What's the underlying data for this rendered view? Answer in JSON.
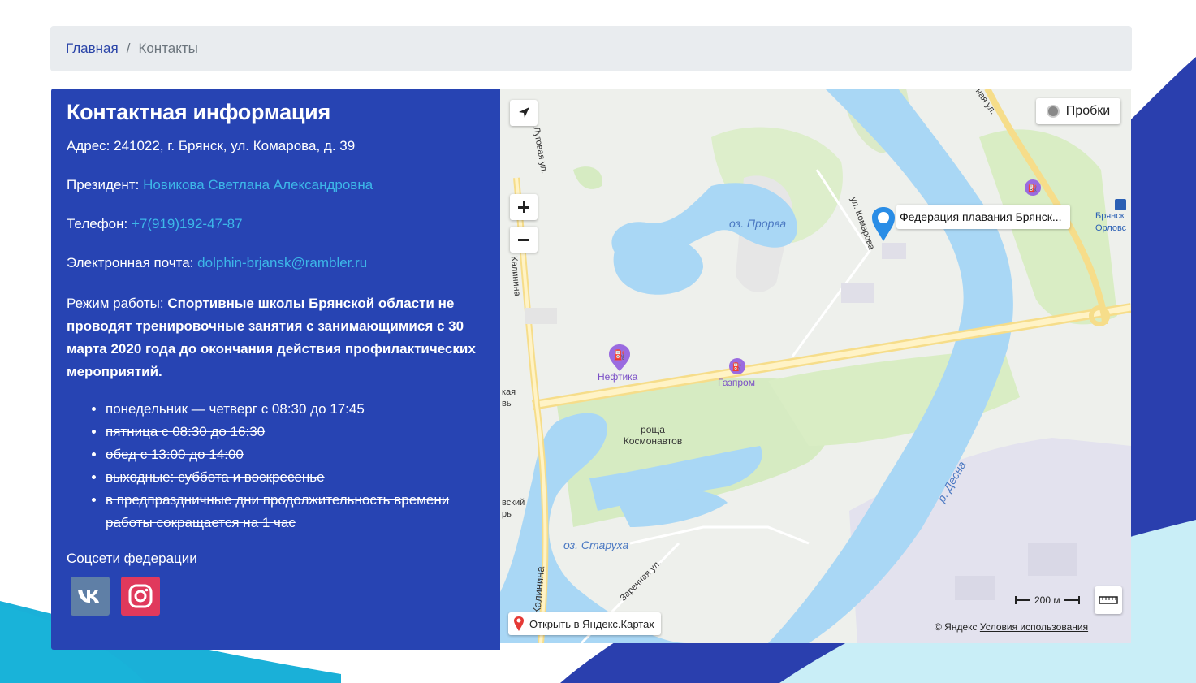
{
  "breadcrumb": {
    "home": "Главная",
    "separator": "/",
    "current": "Контакты"
  },
  "contacts": {
    "title": "Контактная информация",
    "address": "Адрес: 241022, г. Брянск, ул. Комарова, д. 39",
    "president_label": "Президент:",
    "president_name": "Новикова Светлана Александровна",
    "phone_label": "Телефон:",
    "phone": "+7(919)192-47-87",
    "email_label": "Электронная почта:",
    "email": "dolphin-brjansk@rambler.ru",
    "mode_label": "Режим работы:",
    "mode_text": "Спортивные школы Брянской области не проводят тренировочные занятия с занимающимися с 30 марта 2020 года до окончания действия профилактических мероприятий.",
    "schedule": [
      "понедельник — четверг с 08:30 до 17:45",
      "пятница с 08:30 до 16:30",
      "обед с 13:00 до 14:00",
      "выходные: суббота и воскресенье",
      "в предпраздничные дни продолжительность времени работы сокращается на 1 час"
    ],
    "social_title": "Соцсети федерации",
    "social": [
      {
        "name": "vk",
        "icon": "vk-icon",
        "color": "#5f7fa6"
      },
      {
        "name": "instagram",
        "icon": "instagram-icon",
        "color": "#e0395c"
      }
    ]
  },
  "map": {
    "traffic_label": "Пробки",
    "marker_label": "Федерация плавания Брянск...",
    "open_label": "Открыть в Яндекс.Картах",
    "scale_label": "200 м",
    "copyright": "© Яндекс",
    "terms": "Условия использования",
    "labels": {
      "lake1": "оз. Прорва",
      "lake2": "оз. Старуха",
      "river": "р. Десна",
      "poi1": "Нефтика",
      "poi2": "Газпром",
      "park": "роща Космонавтов",
      "street1": "ул. Комарова",
      "street2": "Луговая ул.",
      "street3": "Калинина",
      "street4": "Калинина",
      "street5": "Заречная ул.",
      "street6": "ная ул.",
      "city1": "Брянск",
      "city2": "Орловс",
      "left1": "кая",
      "left2": "вь",
      "left3": "вский",
      "left4": "рь"
    }
  },
  "colors": {
    "panel": "#2744b3",
    "link": "#3db7e8",
    "breadcrumb_bg": "#e9ecef",
    "wave_dark": "#2a3fae",
    "wave_light": "#1ab0d8"
  }
}
